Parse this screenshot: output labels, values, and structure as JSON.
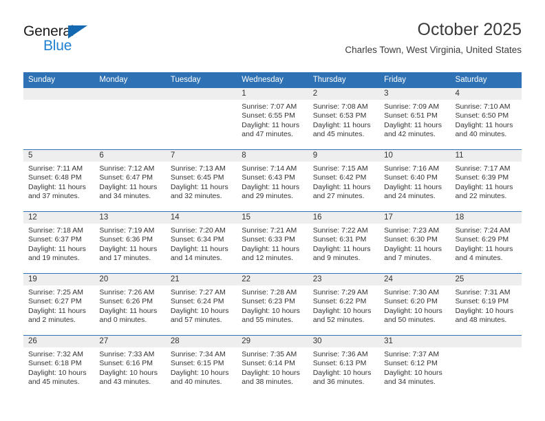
{
  "brand": {
    "word_one": "General",
    "word_two": "Blue",
    "triangle_icon": "triangle-right-icon",
    "accent_color": "#1f7fd0"
  },
  "header": {
    "title": "October 2025",
    "subtitle": "Charles Town, West Virginia, United States"
  },
  "theme": {
    "header_blue": "#2e71b4",
    "date_band_gray": "#eeeeee",
    "text_color": "#333333"
  },
  "calendar": {
    "weekday_headers": [
      "Sunday",
      "Monday",
      "Tuesday",
      "Wednesday",
      "Thursday",
      "Friday",
      "Saturday"
    ],
    "weeks": [
      [
        {
          "date": "",
          "sunrise": "",
          "sunset": "",
          "daylight_line1": "",
          "daylight_line2": ""
        },
        {
          "date": "",
          "sunrise": "",
          "sunset": "",
          "daylight_line1": "",
          "daylight_line2": ""
        },
        {
          "date": "",
          "sunrise": "",
          "sunset": "",
          "daylight_line1": "",
          "daylight_line2": ""
        },
        {
          "date": "1",
          "sunrise": "Sunrise: 7:07 AM",
          "sunset": "Sunset: 6:55 PM",
          "daylight_line1": "Daylight: 11 hours",
          "daylight_line2": "and 47 minutes."
        },
        {
          "date": "2",
          "sunrise": "Sunrise: 7:08 AM",
          "sunset": "Sunset: 6:53 PM",
          "daylight_line1": "Daylight: 11 hours",
          "daylight_line2": "and 45 minutes."
        },
        {
          "date": "3",
          "sunrise": "Sunrise: 7:09 AM",
          "sunset": "Sunset: 6:51 PM",
          "daylight_line1": "Daylight: 11 hours",
          "daylight_line2": "and 42 minutes."
        },
        {
          "date": "4",
          "sunrise": "Sunrise: 7:10 AM",
          "sunset": "Sunset: 6:50 PM",
          "daylight_line1": "Daylight: 11 hours",
          "daylight_line2": "and 40 minutes."
        }
      ],
      [
        {
          "date": "5",
          "sunrise": "Sunrise: 7:11 AM",
          "sunset": "Sunset: 6:48 PM",
          "daylight_line1": "Daylight: 11 hours",
          "daylight_line2": "and 37 minutes."
        },
        {
          "date": "6",
          "sunrise": "Sunrise: 7:12 AM",
          "sunset": "Sunset: 6:47 PM",
          "daylight_line1": "Daylight: 11 hours",
          "daylight_line2": "and 34 minutes."
        },
        {
          "date": "7",
          "sunrise": "Sunrise: 7:13 AM",
          "sunset": "Sunset: 6:45 PM",
          "daylight_line1": "Daylight: 11 hours",
          "daylight_line2": "and 32 minutes."
        },
        {
          "date": "8",
          "sunrise": "Sunrise: 7:14 AM",
          "sunset": "Sunset: 6:43 PM",
          "daylight_line1": "Daylight: 11 hours",
          "daylight_line2": "and 29 minutes."
        },
        {
          "date": "9",
          "sunrise": "Sunrise: 7:15 AM",
          "sunset": "Sunset: 6:42 PM",
          "daylight_line1": "Daylight: 11 hours",
          "daylight_line2": "and 27 minutes."
        },
        {
          "date": "10",
          "sunrise": "Sunrise: 7:16 AM",
          "sunset": "Sunset: 6:40 PM",
          "daylight_line1": "Daylight: 11 hours",
          "daylight_line2": "and 24 minutes."
        },
        {
          "date": "11",
          "sunrise": "Sunrise: 7:17 AM",
          "sunset": "Sunset: 6:39 PM",
          "daylight_line1": "Daylight: 11 hours",
          "daylight_line2": "and 22 minutes."
        }
      ],
      [
        {
          "date": "12",
          "sunrise": "Sunrise: 7:18 AM",
          "sunset": "Sunset: 6:37 PM",
          "daylight_line1": "Daylight: 11 hours",
          "daylight_line2": "and 19 minutes."
        },
        {
          "date": "13",
          "sunrise": "Sunrise: 7:19 AM",
          "sunset": "Sunset: 6:36 PM",
          "daylight_line1": "Daylight: 11 hours",
          "daylight_line2": "and 17 minutes."
        },
        {
          "date": "14",
          "sunrise": "Sunrise: 7:20 AM",
          "sunset": "Sunset: 6:34 PM",
          "daylight_line1": "Daylight: 11 hours",
          "daylight_line2": "and 14 minutes."
        },
        {
          "date": "15",
          "sunrise": "Sunrise: 7:21 AM",
          "sunset": "Sunset: 6:33 PM",
          "daylight_line1": "Daylight: 11 hours",
          "daylight_line2": "and 12 minutes."
        },
        {
          "date": "16",
          "sunrise": "Sunrise: 7:22 AM",
          "sunset": "Sunset: 6:31 PM",
          "daylight_line1": "Daylight: 11 hours",
          "daylight_line2": "and 9 minutes."
        },
        {
          "date": "17",
          "sunrise": "Sunrise: 7:23 AM",
          "sunset": "Sunset: 6:30 PM",
          "daylight_line1": "Daylight: 11 hours",
          "daylight_line2": "and 7 minutes."
        },
        {
          "date": "18",
          "sunrise": "Sunrise: 7:24 AM",
          "sunset": "Sunset: 6:29 PM",
          "daylight_line1": "Daylight: 11 hours",
          "daylight_line2": "and 4 minutes."
        }
      ],
      [
        {
          "date": "19",
          "sunrise": "Sunrise: 7:25 AM",
          "sunset": "Sunset: 6:27 PM",
          "daylight_line1": "Daylight: 11 hours",
          "daylight_line2": "and 2 minutes."
        },
        {
          "date": "20",
          "sunrise": "Sunrise: 7:26 AM",
          "sunset": "Sunset: 6:26 PM",
          "daylight_line1": "Daylight: 11 hours",
          "daylight_line2": "and 0 minutes."
        },
        {
          "date": "21",
          "sunrise": "Sunrise: 7:27 AM",
          "sunset": "Sunset: 6:24 PM",
          "daylight_line1": "Daylight: 10 hours",
          "daylight_line2": "and 57 minutes."
        },
        {
          "date": "22",
          "sunrise": "Sunrise: 7:28 AM",
          "sunset": "Sunset: 6:23 PM",
          "daylight_line1": "Daylight: 10 hours",
          "daylight_line2": "and 55 minutes."
        },
        {
          "date": "23",
          "sunrise": "Sunrise: 7:29 AM",
          "sunset": "Sunset: 6:22 PM",
          "daylight_line1": "Daylight: 10 hours",
          "daylight_line2": "and 52 minutes."
        },
        {
          "date": "24",
          "sunrise": "Sunrise: 7:30 AM",
          "sunset": "Sunset: 6:20 PM",
          "daylight_line1": "Daylight: 10 hours",
          "daylight_line2": "and 50 minutes."
        },
        {
          "date": "25",
          "sunrise": "Sunrise: 7:31 AM",
          "sunset": "Sunset: 6:19 PM",
          "daylight_line1": "Daylight: 10 hours",
          "daylight_line2": "and 48 minutes."
        }
      ],
      [
        {
          "date": "26",
          "sunrise": "Sunrise: 7:32 AM",
          "sunset": "Sunset: 6:18 PM",
          "daylight_line1": "Daylight: 10 hours",
          "daylight_line2": "and 45 minutes."
        },
        {
          "date": "27",
          "sunrise": "Sunrise: 7:33 AM",
          "sunset": "Sunset: 6:16 PM",
          "daylight_line1": "Daylight: 10 hours",
          "daylight_line2": "and 43 minutes."
        },
        {
          "date": "28",
          "sunrise": "Sunrise: 7:34 AM",
          "sunset": "Sunset: 6:15 PM",
          "daylight_line1": "Daylight: 10 hours",
          "daylight_line2": "and 40 minutes."
        },
        {
          "date": "29",
          "sunrise": "Sunrise: 7:35 AM",
          "sunset": "Sunset: 6:14 PM",
          "daylight_line1": "Daylight: 10 hours",
          "daylight_line2": "and 38 minutes."
        },
        {
          "date": "30",
          "sunrise": "Sunrise: 7:36 AM",
          "sunset": "Sunset: 6:13 PM",
          "daylight_line1": "Daylight: 10 hours",
          "daylight_line2": "and 36 minutes."
        },
        {
          "date": "31",
          "sunrise": "Sunrise: 7:37 AM",
          "sunset": "Sunset: 6:12 PM",
          "daylight_line1": "Daylight: 10 hours",
          "daylight_line2": "and 34 minutes."
        },
        {
          "date": "",
          "sunrise": "",
          "sunset": "",
          "daylight_line1": "",
          "daylight_line2": ""
        }
      ]
    ]
  }
}
